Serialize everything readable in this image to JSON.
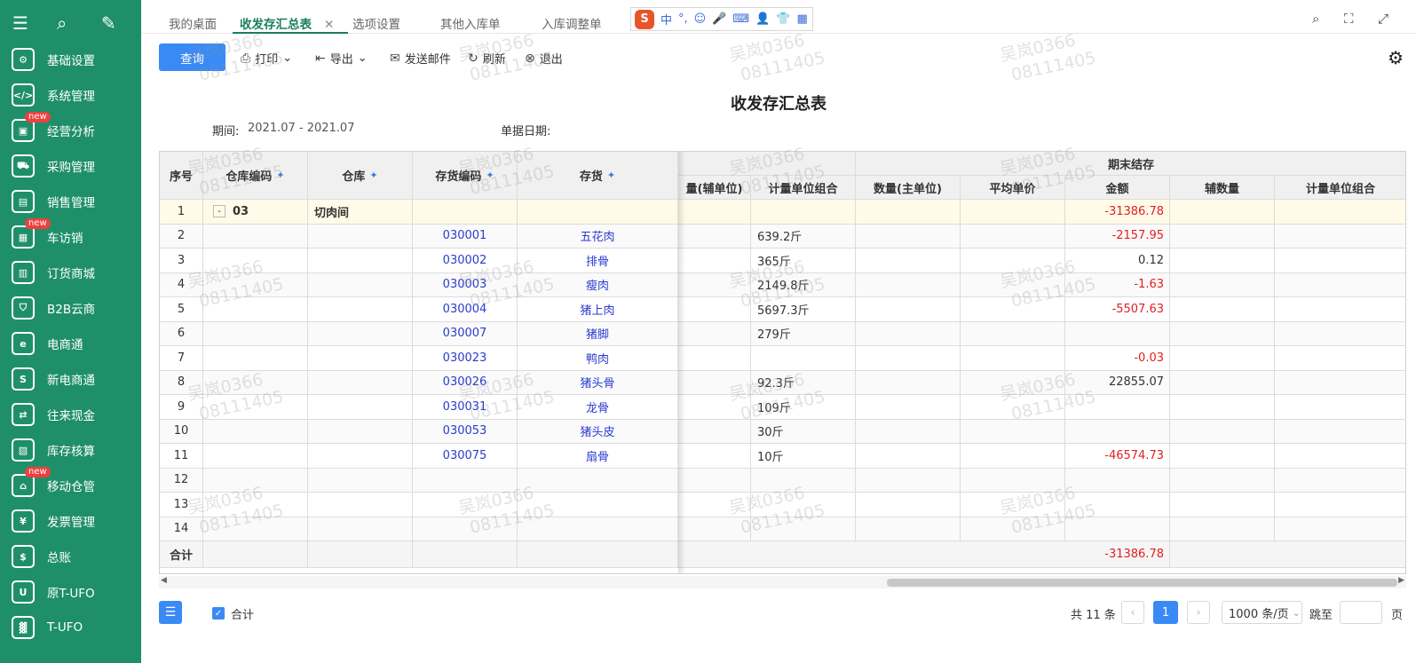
{
  "sidebar": {
    "top_icons": [
      "menu-icon",
      "search-icon",
      "edit-icon"
    ],
    "items": [
      {
        "label": "基础设置",
        "icon": "settings-icon",
        "new": ""
      },
      {
        "label": "系统管理",
        "icon": "code-icon",
        "new": ""
      },
      {
        "label": "经营分析",
        "icon": "monitor-icon",
        "new": "new"
      },
      {
        "label": "采购管理",
        "icon": "cart-icon",
        "new": ""
      },
      {
        "label": "销售管理",
        "icon": "chart-icon",
        "new": ""
      },
      {
        "label": "车访销",
        "icon": "apps-icon",
        "new": "new"
      },
      {
        "label": "订货商城",
        "icon": "store-icon",
        "new": ""
      },
      {
        "label": "B2B云商",
        "icon": "bag-icon",
        "new": ""
      },
      {
        "label": "电商通",
        "icon": "ecommerce-icon",
        "new": ""
      },
      {
        "label": "新电商通",
        "icon": "new-ecommerce-icon",
        "new": ""
      },
      {
        "label": "往来现金",
        "icon": "exchange-icon",
        "new": ""
      },
      {
        "label": "库存核算",
        "icon": "warehouse-icon",
        "new": ""
      },
      {
        "label": "移动仓管",
        "icon": "mobile-warehouse-icon",
        "new": "new"
      },
      {
        "label": "发票管理",
        "icon": "invoice-icon",
        "new": ""
      },
      {
        "label": "总账",
        "icon": "ledger-icon",
        "new": ""
      },
      {
        "label": "原T-UFO",
        "icon": "ufo-icon",
        "new": ""
      },
      {
        "label": "T-UFO",
        "icon": "building-icon",
        "new": ""
      }
    ]
  },
  "tabs": [
    {
      "label": "我的桌面"
    },
    {
      "label": "收发存汇总表"
    },
    {
      "label": "选项设置"
    },
    {
      "label": "其他入库单"
    },
    {
      "label": "入库调整单"
    }
  ],
  "ime": {
    "logo": "S",
    "mode": "中"
  },
  "toolbar": {
    "query": "查询",
    "print": "打印",
    "export": "导出",
    "email": "发送邮件",
    "refresh": "刷新",
    "exit": "退出"
  },
  "report": {
    "title": "收发存汇总表",
    "period_label": "期间:",
    "period_value": "2021.07 - 2021.07",
    "date_label": "单据日期:"
  },
  "table": {
    "frozen_headers": [
      "序号",
      "仓库编码",
      "仓库",
      "存货编码",
      "存货"
    ],
    "scroll_headers": [
      "量(辅单位)",
      "计量单位组合",
      "数量(主单位)",
      "平均单价",
      "金额",
      "辅数量",
      "计量单位组合"
    ],
    "group_header": "期末结存",
    "rows": [
      {
        "no": "1",
        "wh_code": "03",
        "wh": "切肉间",
        "code": "",
        "name": "",
        "unit_combo": "",
        "amount": "-31386.78",
        "expander": "-"
      },
      {
        "no": "2",
        "wh_code": "",
        "wh": "",
        "code": "030001",
        "name": "五花肉",
        "unit_combo": "639.2斤",
        "amount": "-2157.95",
        "expander": ""
      },
      {
        "no": "3",
        "wh_code": "",
        "wh": "",
        "code": "030002",
        "name": "排骨",
        "unit_combo": "365斤",
        "amount": "0.12",
        "expander": ""
      },
      {
        "no": "4",
        "wh_code": "",
        "wh": "",
        "code": "030003",
        "name": "瘦肉",
        "unit_combo": "2149.8斤",
        "amount": "-1.63",
        "expander": ""
      },
      {
        "no": "5",
        "wh_code": "",
        "wh": "",
        "code": "030004",
        "name": "猪上肉",
        "unit_combo": "5697.3斤",
        "amount": "-5507.63",
        "expander": ""
      },
      {
        "no": "6",
        "wh_code": "",
        "wh": "",
        "code": "030007",
        "name": "猪脚",
        "unit_combo": "279斤",
        "amount": "",
        "expander": ""
      },
      {
        "no": "7",
        "wh_code": "",
        "wh": "",
        "code": "030023",
        "name": "鸭肉",
        "unit_combo": "",
        "amount": "-0.03",
        "expander": ""
      },
      {
        "no": "8",
        "wh_code": "",
        "wh": "",
        "code": "030026",
        "name": "猪头骨",
        "unit_combo": "92.3斤",
        "amount": "22855.07",
        "expander": ""
      },
      {
        "no": "9",
        "wh_code": "",
        "wh": "",
        "code": "030031",
        "name": "龙骨",
        "unit_combo": "109斤",
        "amount": "",
        "expander": ""
      },
      {
        "no": "10",
        "wh_code": "",
        "wh": "",
        "code": "030053",
        "name": "猪头皮",
        "unit_combo": "30斤",
        "amount": "",
        "expander": ""
      },
      {
        "no": "11",
        "wh_code": "",
        "wh": "",
        "code": "030075",
        "name": "扇骨",
        "unit_combo": "10斤",
        "amount": "-46574.73",
        "expander": ""
      },
      {
        "no": "12",
        "wh_code": "",
        "wh": "",
        "code": "",
        "name": "",
        "unit_combo": "",
        "amount": "",
        "expander": ""
      },
      {
        "no": "13",
        "wh_code": "",
        "wh": "",
        "code": "",
        "name": "",
        "unit_combo": "",
        "amount": "",
        "expander": ""
      },
      {
        "no": "14",
        "wh_code": "",
        "wh": "",
        "code": "",
        "name": "",
        "unit_combo": "",
        "amount": "",
        "expander": ""
      }
    ],
    "total_label": "合计",
    "total_amount": "-31386.78"
  },
  "footer": {
    "sum_label": "合计",
    "total_text": "共 11 条",
    "prev": "‹",
    "current_page": "1",
    "next": "›",
    "page_size": "1000 条/页",
    "goto_label": "跳至",
    "goto_value": "",
    "page_unit": "页"
  },
  "watermark": {
    "line1": "吴岚0366",
    "line2": "08111405"
  },
  "colors": {
    "sidebar": "#1f8f6a",
    "accent": "#3a8af5",
    "negative": "#e02020",
    "link": "#2a3bd0"
  }
}
